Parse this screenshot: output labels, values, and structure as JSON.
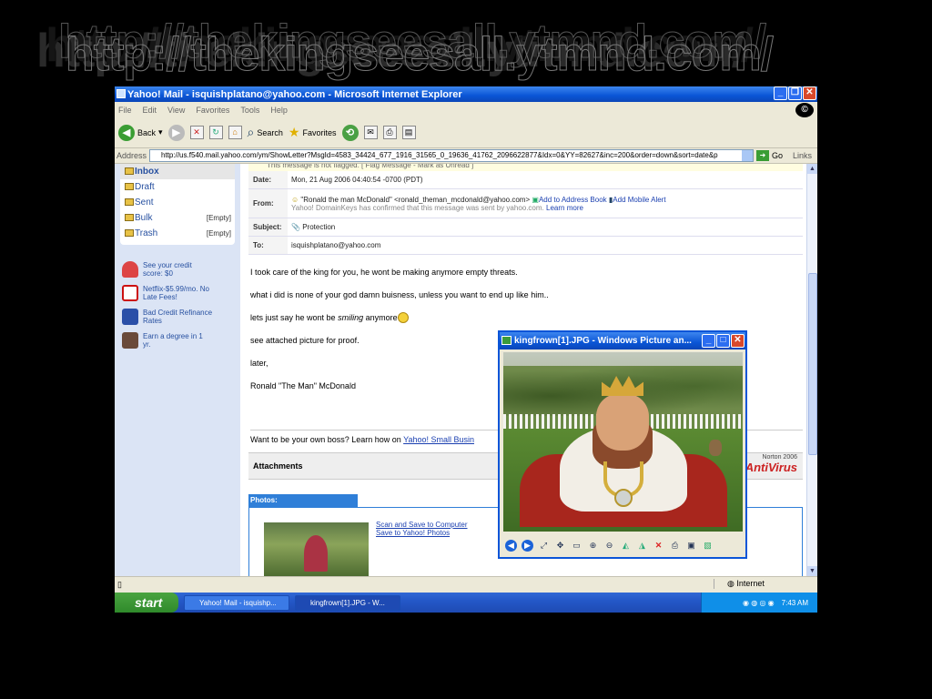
{
  "banner": {
    "text": "http://thekingseesall.ytmnd.com/"
  },
  "ie": {
    "title": "Yahoo! Mail - isquishplatano@yahoo.com - Microsoft Internet Explorer",
    "menu": [
      "File",
      "Edit",
      "View",
      "Favorites",
      "Tools",
      "Help"
    ],
    "toolbar": {
      "back": "Back",
      "search": "Search",
      "favorites": "Favorites"
    },
    "address": {
      "label": "Address",
      "url": "http://us.f540.mail.yahoo.com/ym/ShowLetter?MsgId=4583_34424_677_1916_31565_0_19636_41762_2096622877&Idx=0&YY=82627&inc=200&order=down&sort=date&p",
      "go": "Go",
      "links": "Links"
    },
    "status": {
      "zone": "Internet"
    }
  },
  "folders": [
    {
      "label": "Inbox",
      "count": ""
    },
    {
      "label": "Draft",
      "count": ""
    },
    {
      "label": "Sent",
      "count": ""
    },
    {
      "label": "Bulk",
      "count": "[Empty]"
    },
    {
      "label": "Trash",
      "count": "[Empty]"
    }
  ],
  "ads": [
    {
      "text": "See your credit score: $0"
    },
    {
      "text": "Netflix-$5.99/mo. No Late Fees!"
    },
    {
      "text": "Bad Credit Refinance Rates"
    },
    {
      "text": "Earn a degree in 1 yr."
    }
  ],
  "mail": {
    "flag": "This message is not flagged. [ Flag Message - Mark as Unread ]",
    "date_label": "Date:",
    "date": "Mon, 21 Aug 2006 04:40:54 -0700 (PDT)",
    "from_label": "From:",
    "from": "\"Ronald the man McDonald\" <ronald_theman_mcdonald@yahoo.com>",
    "add_address": "Add to Address Book",
    "add_alert": "Add Mobile Alert",
    "domainkeys": "Yahoo! DomainKeys has confirmed that this message was sent by yahoo.com.",
    "learn_more": "Learn more",
    "subject_label": "Subject:",
    "subject": "Protection",
    "to_label": "To:",
    "to": "isquishplatano@yahoo.com",
    "line1": "I took care of the king for you, he wont be making anymore empty threats.",
    "line2": "what i did is none of your god damn buisness, unless you want to end up like him..",
    "line3a": "lets just say he wont be",
    "line3b": "smiling",
    "line3c": "anymore",
    "line4": "see attached picture for proof.",
    "line5": "later,",
    "line6": "Ronald \"The Man\" McDonald",
    "promo": "Want to be your own boss? Learn how on",
    "promo_link": "Yahoo! Small Busin",
    "attachments": "Attachments",
    "photos": "Photos:",
    "scan_link": "Scan and Save to Computer",
    "save_link": "Save to Yahoo! Photos",
    "norton_small": "Norton",
    "norton_year": "2006",
    "norton_big": "AntiVirus"
  },
  "taskbar": {
    "start": "start",
    "tasks": [
      "Yahoo! Mail - isquishp...",
      "kingfrown[1].JPG - W..."
    ],
    "time": "7:43 AM"
  },
  "viewer": {
    "title": "kingfrown[1].JPG - Windows Picture an..."
  },
  "colors": {
    "xp_blue": "#0a55d6",
    "yahoo_link": "#2750a0",
    "start_green": "#3a9d33",
    "norton_red": "#cc2222"
  }
}
